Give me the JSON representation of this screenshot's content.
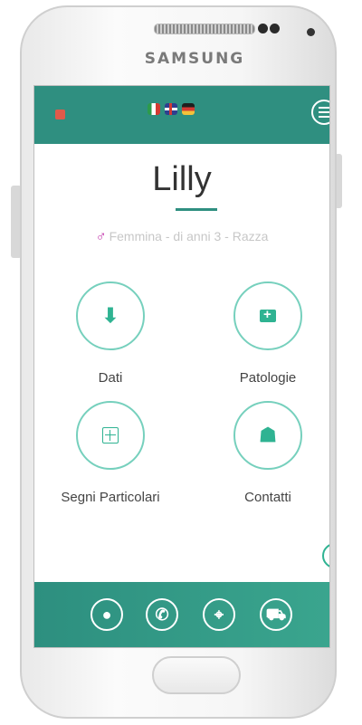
{
  "device": {
    "brand": "SAMSUNG"
  },
  "profile": {
    "name": "Lilly",
    "meta": "Femmina - di anni 3 - Razza",
    "gender_symbol": "♂"
  },
  "tiles": [
    {
      "label": "Dati",
      "icon": "download-icon"
    },
    {
      "label": "Patologie",
      "icon": "medkit-icon"
    },
    {
      "label": "Segni Particolari",
      "icon": "plus-box-icon"
    },
    {
      "label": "Contatti",
      "icon": "users-icon"
    }
  ],
  "languages": [
    "it",
    "en",
    "de"
  ],
  "bottom_nav": [
    {
      "icon": "user-icon",
      "glyph": "●"
    },
    {
      "icon": "phone-icon",
      "glyph": "✆"
    },
    {
      "icon": "location-pin-icon",
      "glyph": "⌖"
    },
    {
      "icon": "truck-icon",
      "glyph": "⛟"
    }
  ],
  "colors": {
    "accent": "#2f8f80",
    "icon_green": "#2fb392",
    "gender": "#c02fa8"
  }
}
